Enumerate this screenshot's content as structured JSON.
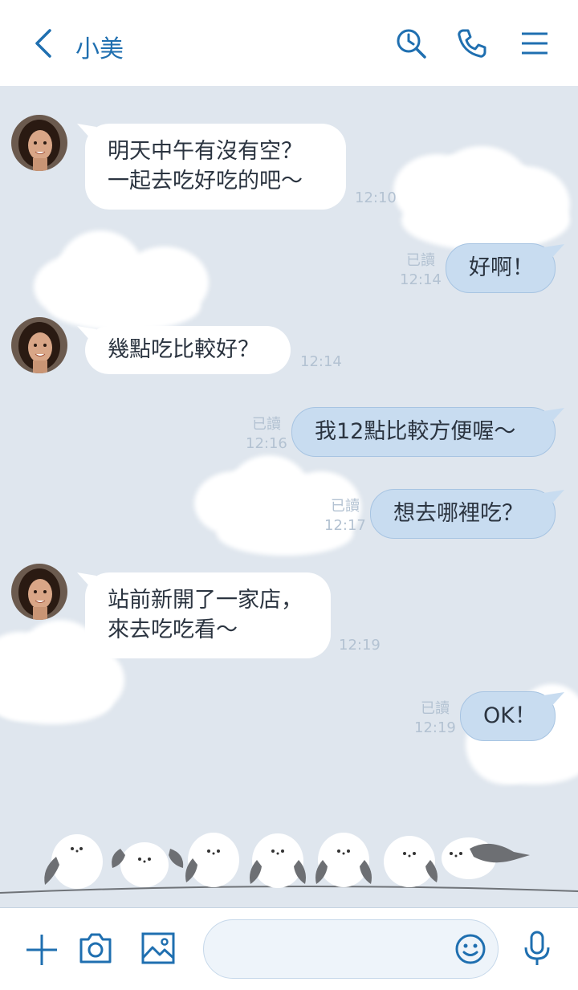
{
  "header": {
    "title": "小美",
    "back_icon": "chevron-left-icon",
    "icons": [
      "search-history-icon",
      "phone-icon",
      "menu-icon"
    ],
    "accent": "#1f6fb0"
  },
  "messages": [
    {
      "side": "left",
      "lines": [
        "明天中午有沒有空？",
        "一起去吃好吃的吧～"
      ],
      "time": "12:10"
    },
    {
      "side": "right",
      "text": "好啊！",
      "read": "已讀",
      "time": "12:14"
    },
    {
      "side": "left",
      "lines": [
        "幾點吃比較好？"
      ],
      "time": "12:14"
    },
    {
      "side": "right",
      "text": "我12點比較方便喔～",
      "read": "已讀",
      "time": "12:16"
    },
    {
      "side": "right",
      "text": "想去哪裡吃？",
      "read": "已讀",
      "time": "12:17"
    },
    {
      "side": "left",
      "lines": [
        "站前新開了一家店，",
        "來去吃吃看～"
      ],
      "time": "12:19"
    },
    {
      "side": "right",
      "text": "OK！",
      "read": "已讀",
      "time": "12:19"
    }
  ],
  "footer": {
    "icons": [
      "plus-icon",
      "camera-icon",
      "image-icon",
      "emoji-icon",
      "microphone-icon"
    ],
    "input_placeholder": ""
  },
  "colors": {
    "chat_bg": "#dfe6ee",
    "my_bubble": "#c8dcf0",
    "their_bubble": "#ffffff",
    "meta_text": "#b3c2d2"
  }
}
